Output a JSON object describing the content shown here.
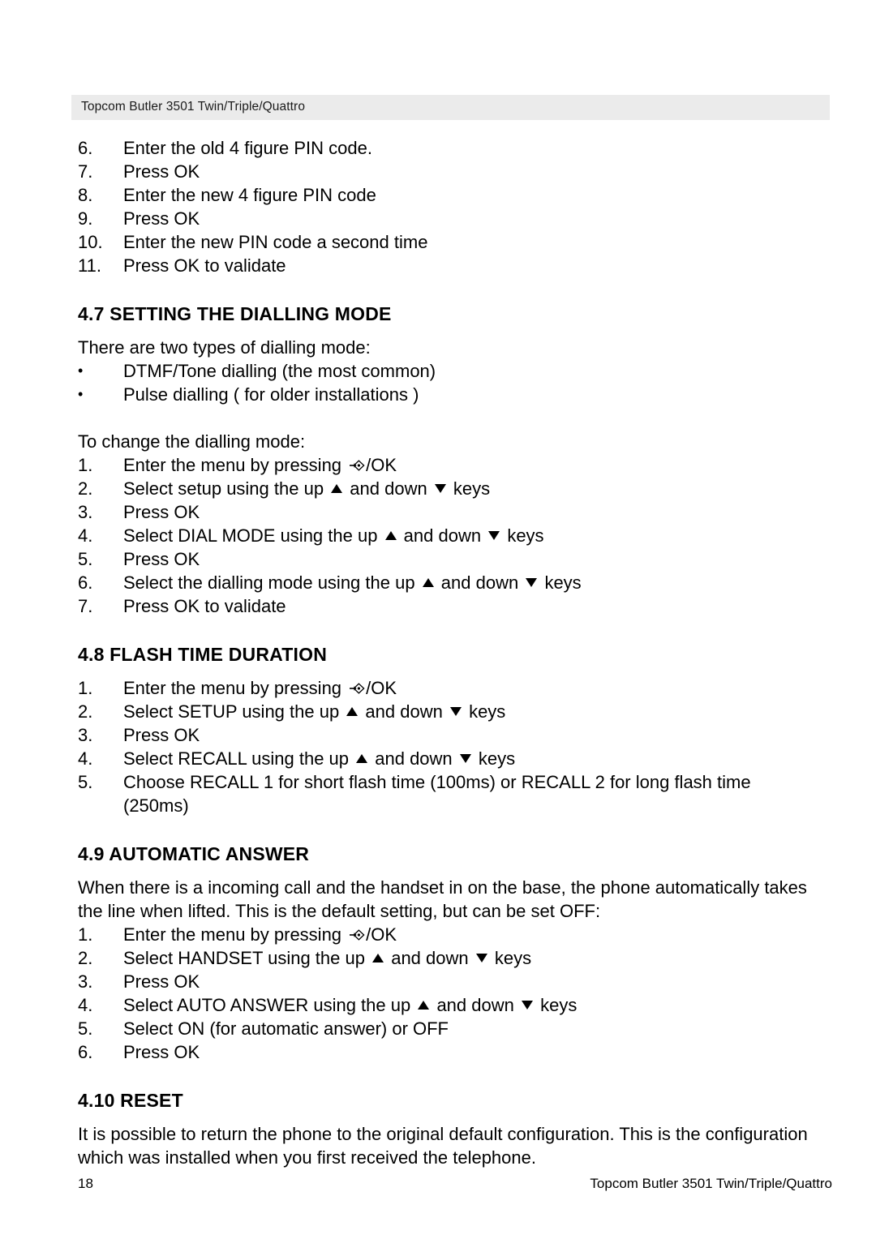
{
  "header": {
    "text": "Topcom Butler 3501 Twin/Triple/Quattro"
  },
  "footer": {
    "page_number": "18",
    "document_title": "Topcom Butler 3501 Twin/Triple/Quattro"
  },
  "icons": {
    "menu_key": "menu-arrow-diamond-icon",
    "up_key": "triangle-up-icon",
    "down_key": "triangle-down-icon"
  },
  "pin_steps": [
    {
      "num": "6.",
      "text": "Enter the old 4 figure PIN code."
    },
    {
      "num": "7.",
      "text": "Press OK"
    },
    {
      "num": "8.",
      "text": "Enter the new 4 figure PIN code"
    },
    {
      "num": "9.",
      "text": "Press OK"
    },
    {
      "num": "10.",
      "text": "Enter the new PIN code a second time"
    },
    {
      "num": "11.",
      "text": "Press OK to validate"
    }
  ],
  "section_47": {
    "heading": "4.7 SETTING THE DIALLING MODE",
    "intro": "There are two types of dialling mode:",
    "bullets": [
      {
        "marker": "•",
        "text": "DTMF/Tone dialling (the most common)"
      },
      {
        "marker": "•",
        "text": "Pulse dialling ( for older installations )"
      }
    ],
    "lead": "To change the dialling mode:",
    "steps": [
      {
        "num": "1.",
        "pre": "Enter the menu by pressing ",
        "icon": "menu",
        "post": "/OK"
      },
      {
        "num": "2.",
        "pre": "Select setup using the up ",
        "icon": "updown",
        "mid": " and down ",
        "post": " keys"
      },
      {
        "num": "3.",
        "pre": "Press OK"
      },
      {
        "num": "4.",
        "pre": "Select DIAL MODE using the up ",
        "icon": "updown",
        "mid": " and down ",
        "post": " keys"
      },
      {
        "num": "5.",
        "pre": "Press OK"
      },
      {
        "num": "6.",
        "pre": "Select the dialling mode using the up ",
        "icon": "updown",
        "mid": " and down ",
        "post": " keys"
      },
      {
        "num": "7.",
        "pre": "Press OK to validate"
      }
    ]
  },
  "section_48": {
    "heading": "4.8 FLASH TIME DURATION",
    "steps": [
      {
        "num": "1.",
        "pre": "Enter the menu by pressing ",
        "icon": "menu",
        "post": "/OK"
      },
      {
        "num": "2.",
        "pre": "Select SETUP using the up ",
        "icon": "updown",
        "mid": " and down ",
        "post": " keys"
      },
      {
        "num": "3.",
        "pre": "Press OK"
      },
      {
        "num": "4.",
        "pre": "Select RECALL using the up ",
        "icon": "updown",
        "mid": " and down ",
        "post": " keys"
      },
      {
        "num": "5.",
        "pre": "Choose RECALL 1 for short flash time (100ms) or RECALL 2 for long flash time",
        "cont": "(250ms)"
      }
    ]
  },
  "section_49": {
    "heading": "4.9 AUTOMATIC ANSWER",
    "paragraph_line1": "When there is a incoming call and the handset in on the base, the phone automatically takes",
    "paragraph_line2": "the line when lifted. This is the default setting, but can be set OFF:",
    "steps": [
      {
        "num": "1.",
        "pre": "Enter the menu by pressing ",
        "icon": "menu",
        "post": "/OK"
      },
      {
        "num": "2.",
        "pre": "Select HANDSET using the up ",
        "icon": "updown",
        "mid": " and down ",
        "post": " keys"
      },
      {
        "num": "3.",
        "pre": "Press OK"
      },
      {
        "num": "4.",
        "pre": "Select AUTO ANSWER using the up ",
        "icon": "updown",
        "mid": " and down ",
        "post": " keys"
      },
      {
        "num": "5.",
        "pre": "Select ON (for automatic answer) or OFF"
      },
      {
        "num": "6.",
        "pre": "Press OK"
      }
    ]
  },
  "section_410": {
    "heading": "4.10 RESET",
    "paragraph_line1": "It is possible to return the phone to the original default configuration. This is the configuration",
    "paragraph_line2": "which was installed when you first received the telephone."
  }
}
